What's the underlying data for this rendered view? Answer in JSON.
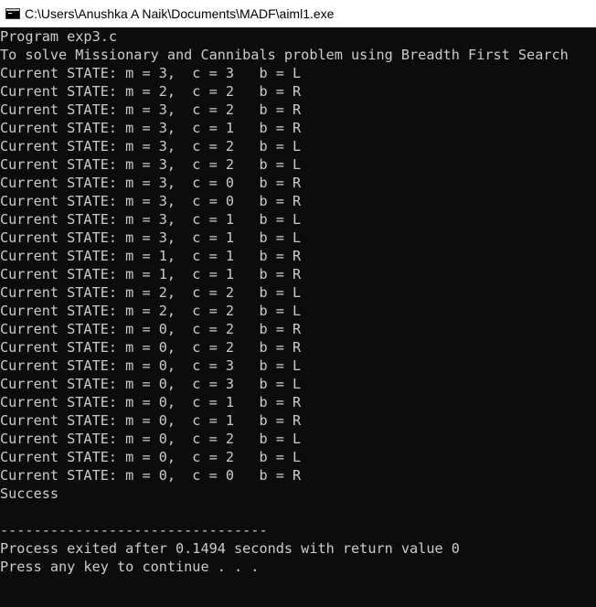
{
  "window": {
    "title": "C:\\Users\\Anushka A Naik\\Documents\\MADF\\aiml1.exe",
    "icon": "console-app-icon"
  },
  "console": {
    "lines": [
      "Program exp3.c",
      "To solve Missionary and Cannibals problem using Breadth First Search",
      "Current STATE: m = 3,  c = 3   b = L",
      "Current STATE: m = 2,  c = 2   b = R",
      "Current STATE: m = 3,  c = 2   b = R",
      "Current STATE: m = 3,  c = 1   b = R",
      "Current STATE: m = 3,  c = 2   b = L",
      "Current STATE: m = 3,  c = 2   b = L",
      "Current STATE: m = 3,  c = 0   b = R",
      "Current STATE: m = 3,  c = 0   b = R",
      "Current STATE: m = 3,  c = 1   b = L",
      "Current STATE: m = 3,  c = 1   b = L",
      "Current STATE: m = 1,  c = 1   b = R",
      "Current STATE: m = 1,  c = 1   b = R",
      "Current STATE: m = 2,  c = 2   b = L",
      "Current STATE: m = 2,  c = 2   b = L",
      "Current STATE: m = 0,  c = 2   b = R",
      "Current STATE: m = 0,  c = 2   b = R",
      "Current STATE: m = 0,  c = 3   b = L",
      "Current STATE: m = 0,  c = 3   b = L",
      "Current STATE: m = 0,  c = 1   b = R",
      "Current STATE: m = 0,  c = 1   b = R",
      "Current STATE: m = 0,  c = 2   b = L",
      "Current STATE: m = 0,  c = 2   b = L",
      "Current STATE: m = 0,  c = 0   b = R",
      "Success",
      "",
      "--------------------------------",
      "Process exited after 0.1494 seconds with return value 0",
      "Press any key to continue . . ."
    ]
  },
  "colors": {
    "console_background": "#0c0c0c",
    "console_text": "#cccccc",
    "titlebar_background": "#ffffff",
    "titlebar_text": "#000000"
  }
}
